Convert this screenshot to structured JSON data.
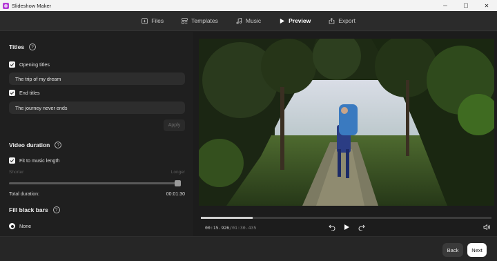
{
  "window": {
    "title": "Slideshow Maker",
    "minimize_glyph": "─",
    "maximize_glyph": "☐",
    "close_glyph": "✕"
  },
  "nav": {
    "tabs": [
      {
        "label": "Files",
        "icon": "file-plus-icon"
      },
      {
        "label": "Templates",
        "icon": "templates-icon"
      },
      {
        "label": "Music",
        "icon": "music-note-icon"
      },
      {
        "label": "Preview",
        "icon": "play-icon",
        "active": true
      },
      {
        "label": "Export",
        "icon": "export-icon"
      }
    ]
  },
  "titles": {
    "heading": "Titles",
    "help_glyph": "?",
    "opening_label": "Opening titles",
    "opening_checked": true,
    "opening_value": "The trip of my dream",
    "end_label": "End titles",
    "end_checked": true,
    "end_value": "The journey never ends",
    "apply_label": "Apply"
  },
  "video_duration": {
    "heading": "Video duration",
    "help_glyph": "?",
    "fit_label": "Fit to music length",
    "fit_checked": true,
    "shorter_label": "Shorter",
    "longer_label": "Longer",
    "slider_value": 1.0,
    "total_label": "Total duration:",
    "total_value": "00:01:30"
  },
  "fill_black_bars": {
    "heading": "Fill black bars",
    "help_glyph": "?",
    "option_none": "None",
    "selected": "None"
  },
  "player": {
    "current": "00:15.926",
    "total": "/01:30.435",
    "progress": 0.177
  },
  "footer": {
    "back_label": "Back",
    "next_label": "Next"
  },
  "colors": {
    "background": "#1f1f1f",
    "panel": "#2d2d2d",
    "accent_icon": "#b23bd6",
    "primary_button": "#ffffff"
  }
}
